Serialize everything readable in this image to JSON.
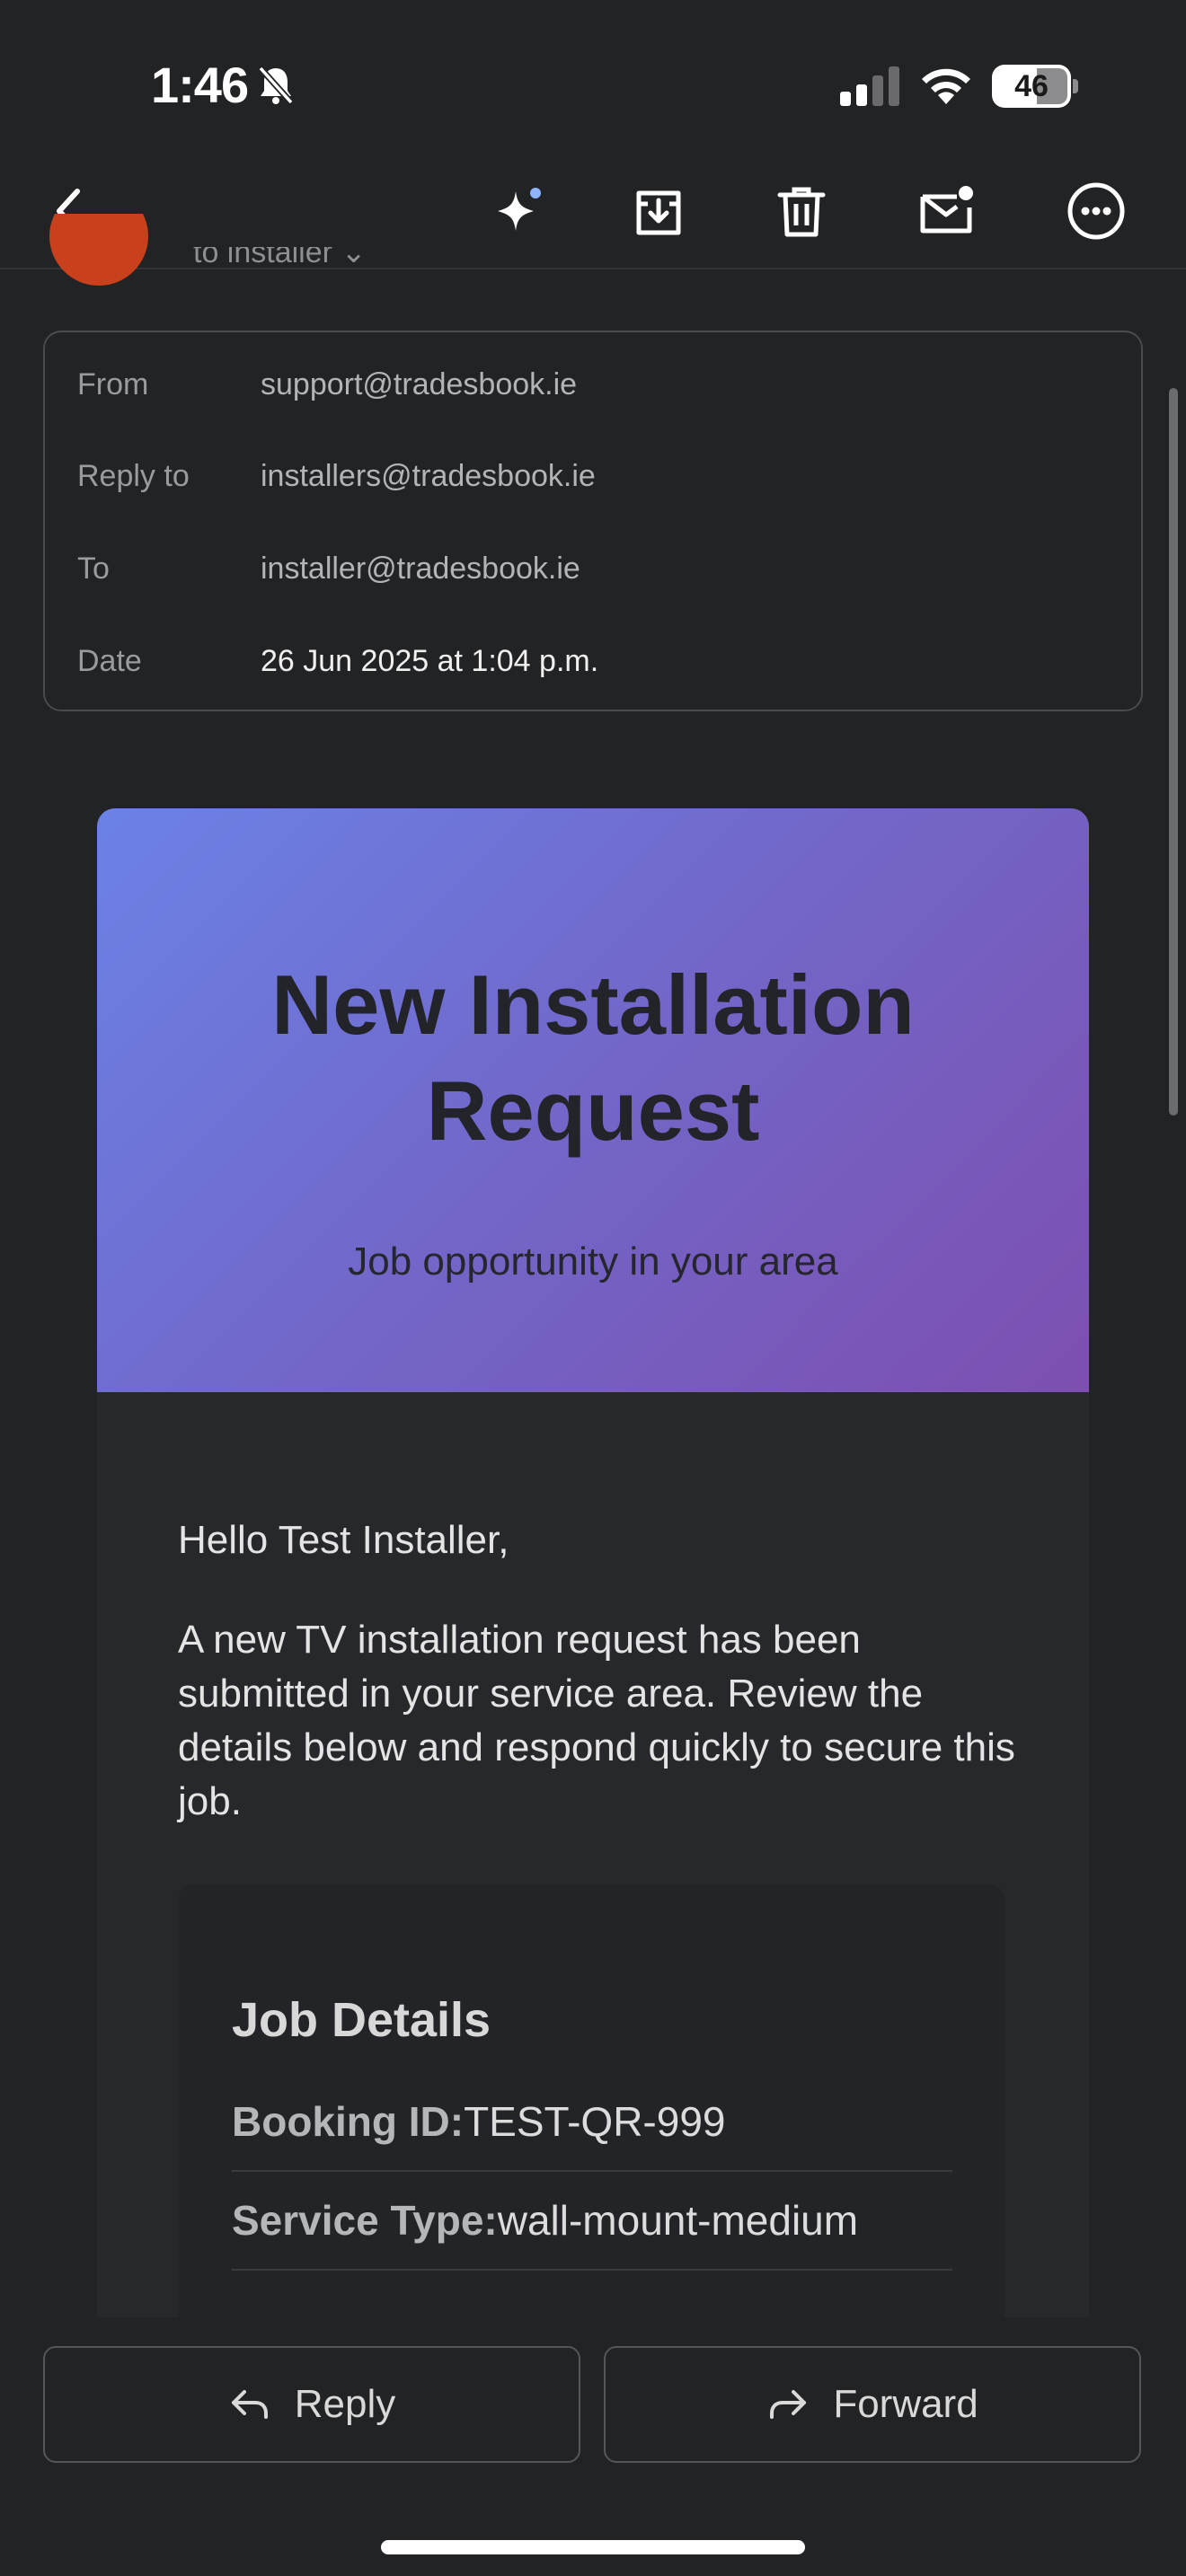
{
  "status_bar": {
    "time": "1:46",
    "battery": "46"
  },
  "toolbar": {
    "icons": [
      "back-icon",
      "sparkle-icon",
      "archive-icon",
      "trash-icon",
      "mark-unread-icon",
      "more-icon"
    ]
  },
  "sender": {
    "to_line": "to installer ⌄"
  },
  "headers": {
    "from_label": "From",
    "from_value": "support@tradesbook.ie",
    "reply_to_label": "Reply to",
    "reply_to_value": "installers@tradesbook.ie",
    "to_label": "To",
    "to_value": "installer@tradesbook.ie",
    "date_label": "Date",
    "date_value": "26 Jun 2025 at 1:04 p.m."
  },
  "email": {
    "hero_title_line1": "New Installation",
    "hero_title_line2": "Request",
    "hero_subtitle": "Job opportunity in your area",
    "greeting": "Hello Test Installer,",
    "intro": "A new TV installation request has been submitted in your service area. Review the details below and respond quickly to secure this job.",
    "job_details_title": "Job Details",
    "job_rows": [
      {
        "key": "Booking ID:",
        "value": "TEST-QR-999"
      },
      {
        "key": "Service Type:",
        "value": "wall-mount-medium"
      }
    ]
  },
  "actions": {
    "reply": "Reply",
    "forward": "Forward"
  },
  "colors": {
    "accent_gradient_start": "#6b82e6",
    "accent_gradient_end": "#7d4fb0",
    "avatar": "#c8411c"
  }
}
